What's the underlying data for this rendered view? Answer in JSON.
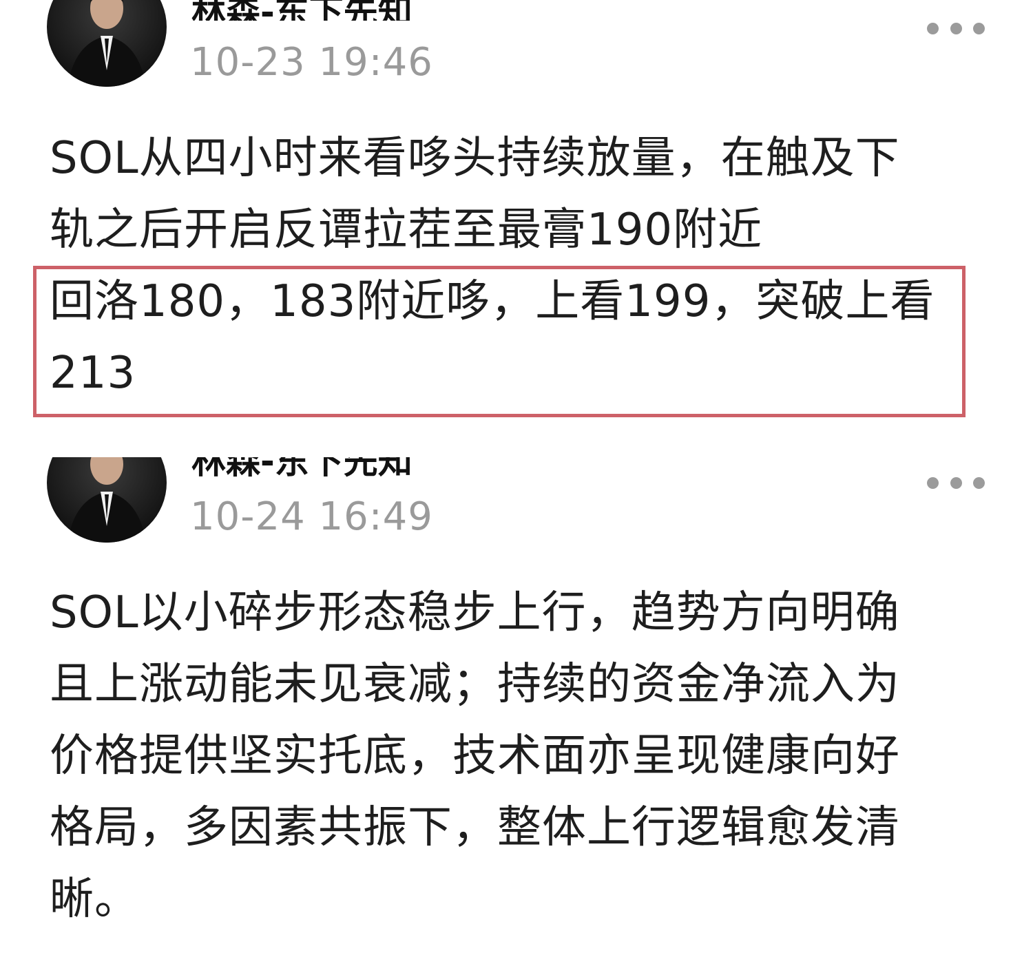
{
  "posts": [
    {
      "author": "林森-东下先知",
      "time": "10-23 19:46",
      "text_lines": [
        "SOL从四小时来看哆头持续放量，在触及下",
        "轨之后开启反谭拉茬至最膏190附近"
      ],
      "highlight_lines": [
        "回洛180，183附近哆，上看199，突破上看",
        "213"
      ],
      "more_icon": "more-horizontal-icon"
    },
    {
      "author": "林森-东下先知",
      "time": "10-24 16:49",
      "text_lines": [
        "SOL以小碎步形态稳步上行，趋势方向明确",
        "且上涨动能未见衰减；持续的资金净流入为",
        "价格提供坚实托底，技术面亦呈现健康向好",
        "格局，多因素共振下，整体上行逻辑愈发清",
        "晰。"
      ],
      "more_icon": "more-horizontal-icon"
    }
  ],
  "colors": {
    "highlight_border": "#cd6168",
    "time_text": "#9a9a9a",
    "body_text": "#1e1e1e",
    "more_dots": "#9b9b9b"
  }
}
